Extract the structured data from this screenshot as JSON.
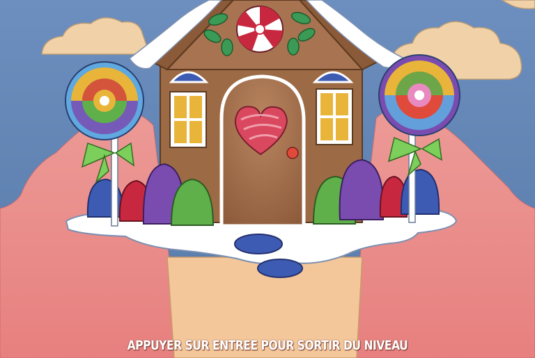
{
  "scene": {
    "description_icon": "gingerbread-house-icon",
    "colors": {
      "sky": "#5f7fb0",
      "cloud": "#f1d2a8",
      "hill": "#e78a88",
      "path": "#f3c79a",
      "gingerbread": "#9c6a45",
      "icing": "#ffffff",
      "heart": "#d9485e"
    }
  },
  "prompt": {
    "text": "APPUYER SUR ENTREE POUR SORTIR DU NIVEAU"
  }
}
